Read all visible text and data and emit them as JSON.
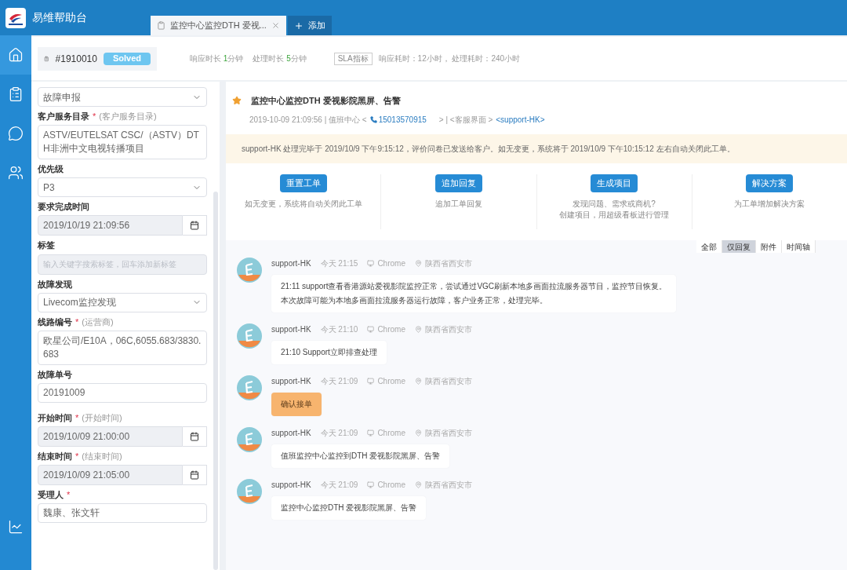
{
  "app": {
    "title": "易维帮助台"
  },
  "tabs": [
    {
      "label": "监控中心监控DTH 爱视...",
      "selected": true,
      "closable": true
    },
    {
      "label": "添加",
      "selected": false,
      "closable": false
    }
  ],
  "nav": [
    {
      "kind": "home",
      "selected": true
    },
    {
      "kind": "ticket",
      "selected": false
    },
    {
      "kind": "chat",
      "selected": false
    },
    {
      "kind": "users",
      "selected": false
    },
    {
      "kind": "chart",
      "selected": false
    }
  ],
  "ticket": {
    "number": "#1910010",
    "status": "Solved",
    "metrics": [
      {
        "label": "响应时长",
        "value": "1",
        "unit": "分钟"
      },
      {
        "label": "处理时长",
        "value": "5",
        "unit": "分钟"
      }
    ],
    "sla_label": "SLA指标",
    "sla_text": "响应耗时：12小时， 处理耗时：240小时"
  },
  "form": [
    {
      "kind": "select",
      "value": "故障申报"
    },
    {
      "kind": "textarea",
      "label": "客户服务目录",
      "mark": "*",
      "hint": "(客户服务目录)",
      "value": "ASTV/EUTELSAT CSC/（ASTV）DTH非洲中文电视转播项目"
    },
    {
      "kind": "select",
      "label": "优先级",
      "value": "P3"
    },
    {
      "kind": "date",
      "label": "要求完成时间",
      "value": "2019/10/19 21:09:56"
    },
    {
      "kind": "tags",
      "label": "标签",
      "placeholder": "输入关键字搜索标签，回车添加新标签"
    },
    {
      "kind": "select",
      "label": "故障发现",
      "value": "Livecom监控发现"
    },
    {
      "kind": "textarea",
      "label": "线路编号",
      "mark": "*",
      "hint": "(运营商)",
      "value": "欧星公司/E10A，06C,6055.683/3830.683"
    },
    {
      "kind": "input",
      "label": "故障单号",
      "value": "20191009"
    },
    {
      "kind": "date",
      "label": "开始时间",
      "mark": "*",
      "hint": "(开始时间)",
      "value": "2019/10/09 21:00:00"
    },
    {
      "kind": "date",
      "label": "结束时间",
      "mark": "*",
      "hint": "(结束时间)",
      "value": "2019/10/09 21:05:00"
    },
    {
      "kind": "input",
      "label": "受理人",
      "mark": "*",
      "value": "魏康、张文轩"
    }
  ],
  "detail": {
    "title": "监控中心监控DTH 爱视影院黑屏、告警",
    "starred": true,
    "meta": {
      "time": "2019-10-09 21:09:56 | 值班中心 <",
      "phone": "15013570915",
      "middle": "> | <客服界面 >",
      "agent": "<support-HK>"
    },
    "notice": "support-HK 处理完毕于 2019/10/9 下午9:15:12，评价问卷已发送给客户。如无变更，系统将于 2019/10/9 下午10:15:12 左右自动关闭此工单。",
    "actions": [
      {
        "button": "重置工单",
        "desc": "如无变更，系统将自动关闭此工单"
      },
      {
        "button": "追加回复",
        "desc": "追加工单回复"
      },
      {
        "button": "生成项目",
        "desc": [
          "发现问题、需求或商机?",
          "创建项目，用超级看板进行管理"
        ]
      },
      {
        "button": "解决方案",
        "desc": "为工单增加解决方案"
      }
    ]
  },
  "filters": [
    {
      "label": "全部",
      "selected": false
    },
    {
      "label": "仅回复",
      "selected": true
    },
    {
      "label": "附件",
      "selected": false
    },
    {
      "label": "时间轴",
      "selected": false
    }
  ],
  "messages": [
    {
      "author": "support-HK",
      "time": "今天 21:15",
      "browser": "Chrome",
      "location": "陕西省西安市",
      "highlight": false,
      "text": [
        "21:11 support查看香港源站爱视影院监控正常，尝试通过VGC刷新本地多画面拉流服务器节目，监控节目恢复。",
        "本次故障可能为本地多画面拉流服务器运行故障，客户业务正常，处理完毕。"
      ]
    },
    {
      "author": "support-HK",
      "time": "今天 21:10",
      "browser": "Chrome",
      "location": "陕西省西安市",
      "highlight": false,
      "text": "21:10 Support立即排查处理"
    },
    {
      "author": "support-HK",
      "time": "今天 21:09",
      "browser": "Chrome",
      "location": "陕西省西安市",
      "highlight": true,
      "text": "确认接单"
    },
    {
      "author": "support-HK",
      "time": "今天 21:09",
      "browser": "Chrome",
      "location": "陕西省西安市",
      "highlight": false,
      "text": "值班监控中心监控到DTH 爱视影院黑屏、告警"
    },
    {
      "author": "support-HK",
      "time": "今天 21:09",
      "browser": "Chrome",
      "location": "陕西省西安市",
      "highlight": false,
      "text": "监控中心监控DTH 爱视影院黑屏、告警"
    }
  ]
}
